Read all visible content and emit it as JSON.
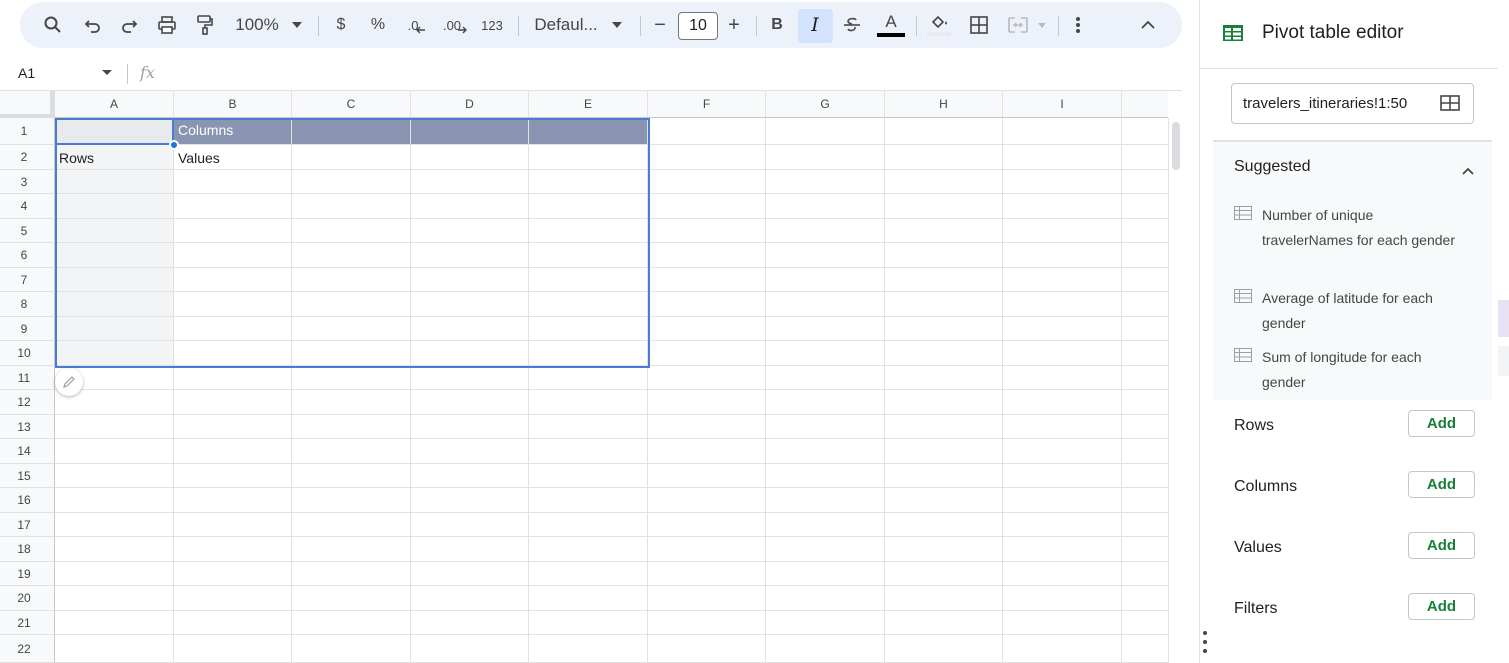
{
  "toolbar": {
    "zoom": "100%",
    "currency": "$",
    "percent": "%",
    "decrease_decimal": ".0",
    "increase_decimal": ".00",
    "number_format": "123",
    "font": "Defaul...",
    "font_size_minus": "−",
    "font_size": "10",
    "font_size_plus": "+",
    "bold": "B",
    "italic": "I",
    "text_color": "A"
  },
  "formula_bar": {
    "cell_ref": "A1",
    "fx": "fx"
  },
  "columns": [
    "A",
    "B",
    "C",
    "D",
    "E",
    "F",
    "G",
    "H",
    "I"
  ],
  "rows": [
    "1",
    "2",
    "3",
    "4",
    "5",
    "6",
    "7",
    "8",
    "9",
    "10",
    "11",
    "12",
    "13",
    "14",
    "15",
    "16",
    "17",
    "18",
    "19",
    "20",
    "21",
    "22"
  ],
  "cells": {
    "b1": "Columns",
    "a2": "Rows",
    "b2": "Values"
  },
  "panel": {
    "title": "Pivot table editor",
    "range": "travelers_itineraries!1:50",
    "suggested_title": "Suggested",
    "suggestions": [
      "Number of unique travelerNames for each gender",
      "Average of latitude for each gender",
      "Sum of longitude for each gender"
    ],
    "sections": [
      {
        "label": "Rows",
        "button": "Add"
      },
      {
        "label": "Columns",
        "button": "Add"
      },
      {
        "label": "Values",
        "button": "Add"
      },
      {
        "label": "Filters",
        "button": "Add"
      }
    ]
  },
  "colors": {
    "accent": "#1a73e8",
    "pivot_header": "#8995b1",
    "add_green": "#188038",
    "toolbar_bg": "#edf2fa"
  }
}
